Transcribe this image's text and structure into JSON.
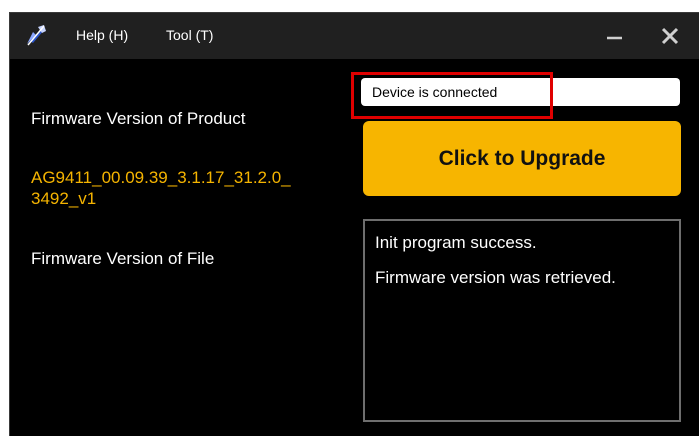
{
  "menu": {
    "help": "Help (H)",
    "tool": "Tool (T)"
  },
  "labels": {
    "product_version": "Firmware Version of Product",
    "file_version": "Firmware Version of File"
  },
  "product_firmware_version": "AG9411_00.09.39_3.1.17_31.2.0_ 3492_v1",
  "status": "Device is connected",
  "upgrade_button_label": "Click to Upgrade",
  "log": [
    "Init program success.",
    "Firmware version was retrieved."
  ],
  "colors": {
    "accent": "#F7B500",
    "version_text": "#F5B400",
    "highlight": "#E00000",
    "window_bg": "#000000",
    "titlebar_bg": "#202020"
  },
  "icons": {
    "app": "app-logo-icon",
    "minimize": "minimize-icon",
    "close": "close-icon"
  }
}
